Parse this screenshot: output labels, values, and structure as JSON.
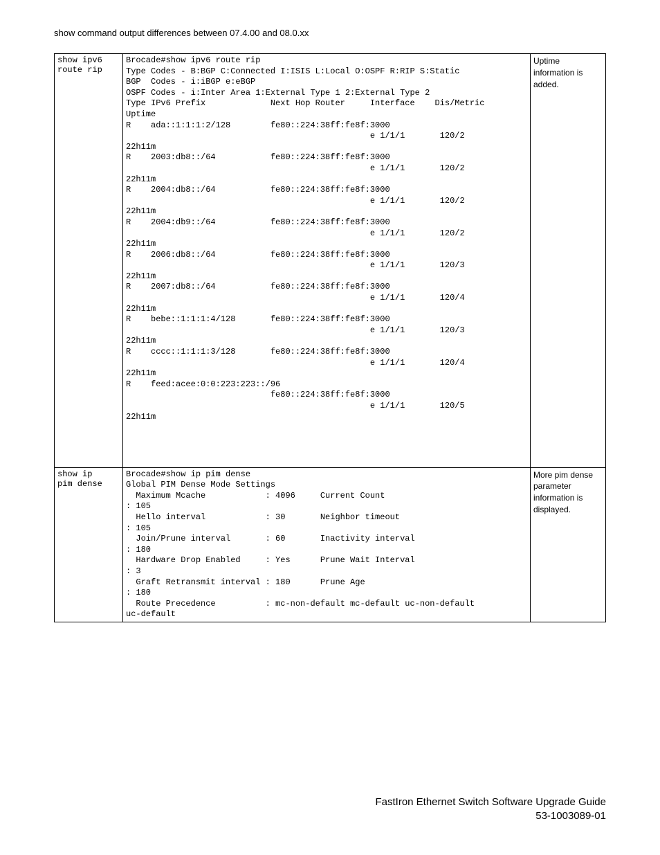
{
  "header": {
    "title": "show command output differences between 07.4.00 and 08.0.xx"
  },
  "rows": [
    {
      "command": "show ipv6\nroute rip",
      "output": "Brocade#show ipv6 route rip\nType Codes - B:BGP C:Connected I:ISIS L:Local O:OSPF R:RIP S:Static\nBGP  Codes - i:iBGP e:eBGP\nOSPF Codes - i:Inter Area 1:External Type 1 2:External Type 2\nType IPv6 Prefix             Next Hop Router     Interface    Dis/Metric\nUptime\nR    ada::1:1:1:2/128        fe80::224:38ff:fe8f:3000\n                                                 e 1/1/1       120/2\n22h11m\nR    2003:db8::/64           fe80::224:38ff:fe8f:3000\n                                                 e 1/1/1       120/2\n22h11m\nR    2004:db8::/64           fe80::224:38ff:fe8f:3000\n                                                 e 1/1/1       120/2\n22h11m\nR    2004:db9::/64           fe80::224:38ff:fe8f:3000\n                                                 e 1/1/1       120/2\n22h11m\nR    2006:db8::/64           fe80::224:38ff:fe8f:3000\n                                                 e 1/1/1       120/3\n22h11m\nR    2007:db8::/64           fe80::224:38ff:fe8f:3000\n                                                 e 1/1/1       120/4\n22h11m\nR    bebe::1:1:1:4/128       fe80::224:38ff:fe8f:3000\n                                                 e 1/1/1       120/3\n22h11m\nR    cccc::1:1:1:3/128       fe80::224:38ff:fe8f:3000\n                                                 e 1/1/1       120/4\n22h11m\nR    feed:acee:0:0:223:223::/96\n                             fe80::224:38ff:fe8f:3000\n                                                 e 1/1/1       120/5\n22h11m\n\n\n\n\n",
      "note": "Uptime information is added."
    },
    {
      "command": "show ip\npim dense",
      "output": "Brocade#show ip pim dense\nGlobal PIM Dense Mode Settings\n  Maximum Mcache            : 4096     Current Count\n: 105\n  Hello interval            : 30       Neighbor timeout\n: 105\n  Join/Prune interval       : 60       Inactivity interval\n: 180\n  Hardware Drop Enabled     : Yes      Prune Wait Interval\n: 3\n  Graft Retransmit interval : 180      Prune Age\n: 180\n  Route Precedence          : mc-non-default mc-default uc-non-default\nuc-default\n",
      "note": "More pim dense parameter information is displayed."
    }
  ],
  "footer": {
    "line1": "FastIron Ethernet Switch Software Upgrade Guide",
    "line2": "53-1003089-01"
  }
}
